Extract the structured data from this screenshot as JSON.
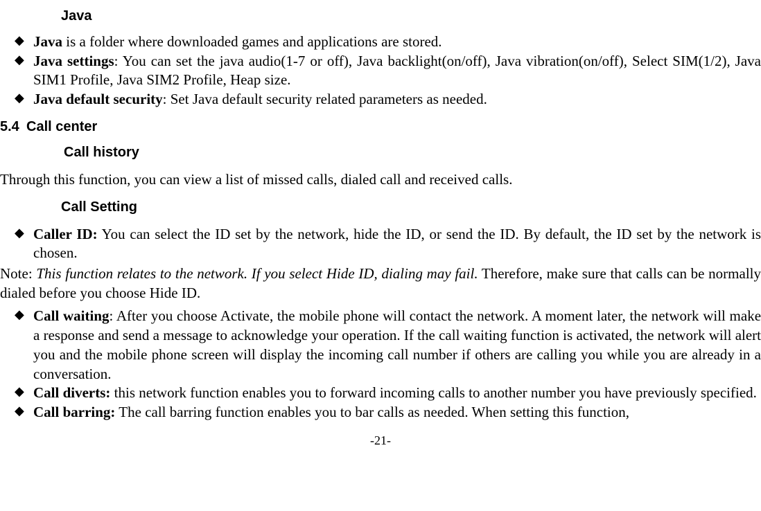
{
  "java": {
    "heading": "Java",
    "items": [
      {
        "term": "Java",
        "rest": " is a folder where downloaded games and applications are stored."
      },
      {
        "term": "Java settings",
        "rest": ": You can set the java audio(1-7 or off), Java backlight(on/off), Java vibration(on/off), Select SIM(1/2), Java SIM1 Profile, Java SIM2 Profile, Heap size."
      },
      {
        "term": "Java default security",
        "rest": ": Set Java default security related parameters as needed."
      }
    ]
  },
  "section": {
    "number": "5.4",
    "title": "Call center"
  },
  "call_history": {
    "heading": "Call history",
    "body": "Through this function, you can view a list of missed calls, dialed call and received calls."
  },
  "call_setting": {
    "heading": "Call Setting",
    "items": [
      {
        "term": "Caller ID:",
        "rest": " You can select the ID set by the network, hide the ID, or send the ID. By default, the ID set by the network is chosen."
      }
    ],
    "note_prefix": "Note: ",
    "note_italic": "This function relates to the network. If you select Hide ID, dialing may fail.",
    "note_suffix": " Therefore, make sure that calls can be normally dialed before you choose Hide ID.",
    "items2": [
      {
        "term": "Call waiting",
        "rest": ": After you choose Activate, the mobile phone will contact the network. A moment later, the network will make a response and send a message to acknowledge your operation. If the call waiting function is activated, the network will alert you and the mobile phone screen will display the incoming call number if others are calling you while you are already in a conversation."
      },
      {
        "term": "Call diverts:",
        "rest": " this network function enables you to forward incoming calls to another number you have previously specified."
      },
      {
        "term": "Call barring:",
        "rest": " The call barring function enables you to bar calls as needed. When setting this function,"
      }
    ]
  },
  "page_number": "-21-"
}
